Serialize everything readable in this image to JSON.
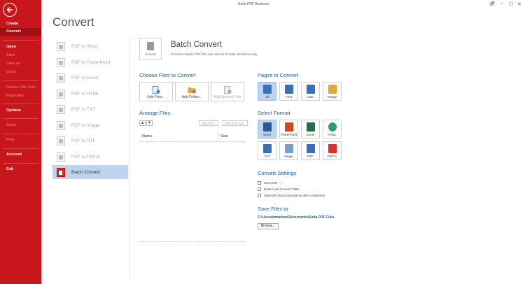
{
  "window": {
    "title": "Soda PDF Business",
    "controls": [
      "🗗",
      "–",
      "☐",
      "✕"
    ]
  },
  "sidebar": {
    "items": [
      {
        "label": "Create",
        "state": "strong"
      },
      {
        "label": "Convert",
        "state": "active"
      },
      {
        "label": "Open",
        "state": "strong"
      },
      {
        "label": "Save",
        "state": "dim"
      },
      {
        "label": "Save as",
        "state": "dim"
      },
      {
        "label": "Close",
        "state": "dim"
      },
      {
        "label": "Reduce File Size",
        "state": "dim"
      },
      {
        "label": "Properties",
        "state": "dim"
      },
      {
        "label": "Options",
        "state": "strong"
      },
      {
        "label": "Send",
        "state": "dim"
      },
      {
        "label": "Print",
        "state": "dim"
      },
      {
        "label": "Account",
        "state": "strong"
      },
      {
        "label": "Exit",
        "state": "strong"
      }
    ]
  },
  "page_title": "Convert",
  "conversions": [
    {
      "label": "PDF to Word"
    },
    {
      "label": "PDF to PowerPoint"
    },
    {
      "label": "PDF to Excel"
    },
    {
      "label": "PDF to HTML"
    },
    {
      "label": "PDF to TXT"
    },
    {
      "label": "PDF to Image"
    },
    {
      "label": "PDF to RTF"
    },
    {
      "label": "PDF to PDF/A"
    },
    {
      "label": "Batch Convert",
      "selected": true
    }
  ],
  "header": {
    "icon_label": "Convert",
    "title": "Batch Convert",
    "subtitle": "Convert multiple PDF files into various formats simultaneously."
  },
  "choose_files": {
    "title": "Choose Files to Convert",
    "buttons": [
      {
        "label": "Add Files...",
        "color": "#4a7fc1"
      },
      {
        "label": "Add Folder...",
        "color": "#e8a33a"
      },
      {
        "label": "Add Opened Files",
        "color": "#9aa8b8"
      }
    ]
  },
  "arrange_files": {
    "title": "Arrange Files",
    "up": "▲",
    "down": "▼",
    "delete": "DELETE",
    "delete_all": "DELETE ALL",
    "col_name": "Name",
    "col_size": "Size"
  },
  "pages": {
    "title": "Pages to Convert",
    "options": [
      {
        "label": "All",
        "selected": true,
        "color": "#3b6fb6"
      },
      {
        "label": "First",
        "color": "#3b6fb6"
      },
      {
        "label": "Last",
        "color": "#3b6fb6"
      },
      {
        "label": "Range",
        "color": "#e8a33a"
      }
    ]
  },
  "formats": {
    "title": "Select Format",
    "options": [
      {
        "label": "Word",
        "selected": true,
        "color": "#2b5797"
      },
      {
        "label": "PowerPoint",
        "color": "#d24726"
      },
      {
        "label": "Excel",
        "color": "#1e7145"
      },
      {
        "label": "HTML",
        "color": "#2e9c6b"
      },
      {
        "label": "TXT",
        "color": "#3c6eb4"
      },
      {
        "label": "Image",
        "color": "#7a9cc6"
      },
      {
        "label": "RTF",
        "color": "#3c6eb4"
      },
      {
        "label": "PDF/A",
        "color": "#d9332b"
      }
    ]
  },
  "settings": {
    "title": "Convert Settings",
    "options": [
      {
        "label": "Use OCR",
        "info": "ⓘ"
      },
      {
        "label": "Detect and Convert Table"
      },
      {
        "label": "Open MS Word documents after conversion"
      }
    ]
  },
  "save": {
    "title": "Save Files to",
    "path": "C:\\Users\\nmarban\\Documents\\Soda PDF Files",
    "browse": "Browse..."
  }
}
